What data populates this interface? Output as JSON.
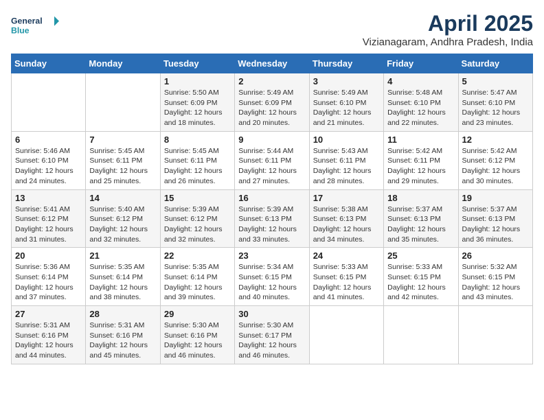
{
  "header": {
    "logo_line1": "General",
    "logo_line2": "Blue",
    "month_year": "April 2025",
    "location": "Vizianagaram, Andhra Pradesh, India"
  },
  "weekdays": [
    "Sunday",
    "Monday",
    "Tuesday",
    "Wednesday",
    "Thursday",
    "Friday",
    "Saturday"
  ],
  "weeks": [
    [
      {
        "day": "",
        "sunrise": "",
        "sunset": "",
        "daylight": ""
      },
      {
        "day": "",
        "sunrise": "",
        "sunset": "",
        "daylight": ""
      },
      {
        "day": "1",
        "sunrise": "Sunrise: 5:50 AM",
        "sunset": "Sunset: 6:09 PM",
        "daylight": "Daylight: 12 hours and 18 minutes."
      },
      {
        "day": "2",
        "sunrise": "Sunrise: 5:49 AM",
        "sunset": "Sunset: 6:09 PM",
        "daylight": "Daylight: 12 hours and 20 minutes."
      },
      {
        "day": "3",
        "sunrise": "Sunrise: 5:49 AM",
        "sunset": "Sunset: 6:10 PM",
        "daylight": "Daylight: 12 hours and 21 minutes."
      },
      {
        "day": "4",
        "sunrise": "Sunrise: 5:48 AM",
        "sunset": "Sunset: 6:10 PM",
        "daylight": "Daylight: 12 hours and 22 minutes."
      },
      {
        "day": "5",
        "sunrise": "Sunrise: 5:47 AM",
        "sunset": "Sunset: 6:10 PM",
        "daylight": "Daylight: 12 hours and 23 minutes."
      }
    ],
    [
      {
        "day": "6",
        "sunrise": "Sunrise: 5:46 AM",
        "sunset": "Sunset: 6:10 PM",
        "daylight": "Daylight: 12 hours and 24 minutes."
      },
      {
        "day": "7",
        "sunrise": "Sunrise: 5:45 AM",
        "sunset": "Sunset: 6:11 PM",
        "daylight": "Daylight: 12 hours and 25 minutes."
      },
      {
        "day": "8",
        "sunrise": "Sunrise: 5:45 AM",
        "sunset": "Sunset: 6:11 PM",
        "daylight": "Daylight: 12 hours and 26 minutes."
      },
      {
        "day": "9",
        "sunrise": "Sunrise: 5:44 AM",
        "sunset": "Sunset: 6:11 PM",
        "daylight": "Daylight: 12 hours and 27 minutes."
      },
      {
        "day": "10",
        "sunrise": "Sunrise: 5:43 AM",
        "sunset": "Sunset: 6:11 PM",
        "daylight": "Daylight: 12 hours and 28 minutes."
      },
      {
        "day": "11",
        "sunrise": "Sunrise: 5:42 AM",
        "sunset": "Sunset: 6:11 PM",
        "daylight": "Daylight: 12 hours and 29 minutes."
      },
      {
        "day": "12",
        "sunrise": "Sunrise: 5:42 AM",
        "sunset": "Sunset: 6:12 PM",
        "daylight": "Daylight: 12 hours and 30 minutes."
      }
    ],
    [
      {
        "day": "13",
        "sunrise": "Sunrise: 5:41 AM",
        "sunset": "Sunset: 6:12 PM",
        "daylight": "Daylight: 12 hours and 31 minutes."
      },
      {
        "day": "14",
        "sunrise": "Sunrise: 5:40 AM",
        "sunset": "Sunset: 6:12 PM",
        "daylight": "Daylight: 12 hours and 32 minutes."
      },
      {
        "day": "15",
        "sunrise": "Sunrise: 5:39 AM",
        "sunset": "Sunset: 6:12 PM",
        "daylight": "Daylight: 12 hours and 32 minutes."
      },
      {
        "day": "16",
        "sunrise": "Sunrise: 5:39 AM",
        "sunset": "Sunset: 6:13 PM",
        "daylight": "Daylight: 12 hours and 33 minutes."
      },
      {
        "day": "17",
        "sunrise": "Sunrise: 5:38 AM",
        "sunset": "Sunset: 6:13 PM",
        "daylight": "Daylight: 12 hours and 34 minutes."
      },
      {
        "day": "18",
        "sunrise": "Sunrise: 5:37 AM",
        "sunset": "Sunset: 6:13 PM",
        "daylight": "Daylight: 12 hours and 35 minutes."
      },
      {
        "day": "19",
        "sunrise": "Sunrise: 5:37 AM",
        "sunset": "Sunset: 6:13 PM",
        "daylight": "Daylight: 12 hours and 36 minutes."
      }
    ],
    [
      {
        "day": "20",
        "sunrise": "Sunrise: 5:36 AM",
        "sunset": "Sunset: 6:14 PM",
        "daylight": "Daylight: 12 hours and 37 minutes."
      },
      {
        "day": "21",
        "sunrise": "Sunrise: 5:35 AM",
        "sunset": "Sunset: 6:14 PM",
        "daylight": "Daylight: 12 hours and 38 minutes."
      },
      {
        "day": "22",
        "sunrise": "Sunrise: 5:35 AM",
        "sunset": "Sunset: 6:14 PM",
        "daylight": "Daylight: 12 hours and 39 minutes."
      },
      {
        "day": "23",
        "sunrise": "Sunrise: 5:34 AM",
        "sunset": "Sunset: 6:15 PM",
        "daylight": "Daylight: 12 hours and 40 minutes."
      },
      {
        "day": "24",
        "sunrise": "Sunrise: 5:33 AM",
        "sunset": "Sunset: 6:15 PM",
        "daylight": "Daylight: 12 hours and 41 minutes."
      },
      {
        "day": "25",
        "sunrise": "Sunrise: 5:33 AM",
        "sunset": "Sunset: 6:15 PM",
        "daylight": "Daylight: 12 hours and 42 minutes."
      },
      {
        "day": "26",
        "sunrise": "Sunrise: 5:32 AM",
        "sunset": "Sunset: 6:15 PM",
        "daylight": "Daylight: 12 hours and 43 minutes."
      }
    ],
    [
      {
        "day": "27",
        "sunrise": "Sunrise: 5:31 AM",
        "sunset": "Sunset: 6:16 PM",
        "daylight": "Daylight: 12 hours and 44 minutes."
      },
      {
        "day": "28",
        "sunrise": "Sunrise: 5:31 AM",
        "sunset": "Sunset: 6:16 PM",
        "daylight": "Daylight: 12 hours and 45 minutes."
      },
      {
        "day": "29",
        "sunrise": "Sunrise: 5:30 AM",
        "sunset": "Sunset: 6:16 PM",
        "daylight": "Daylight: 12 hours and 46 minutes."
      },
      {
        "day": "30",
        "sunrise": "Sunrise: 5:30 AM",
        "sunset": "Sunset: 6:17 PM",
        "daylight": "Daylight: 12 hours and 46 minutes."
      },
      {
        "day": "",
        "sunrise": "",
        "sunset": "",
        "daylight": ""
      },
      {
        "day": "",
        "sunrise": "",
        "sunset": "",
        "daylight": ""
      },
      {
        "day": "",
        "sunrise": "",
        "sunset": "",
        "daylight": ""
      }
    ]
  ]
}
